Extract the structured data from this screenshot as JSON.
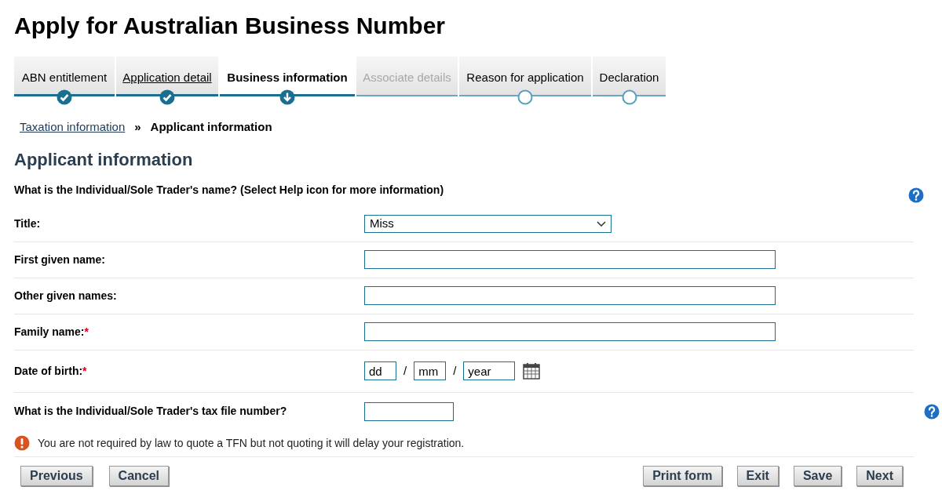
{
  "page_title": "Apply for Australian Business Number",
  "steps": [
    {
      "label": "ABN entitlement",
      "completed": true,
      "disabled": false,
      "link": false,
      "selected": false
    },
    {
      "label": "Application detail",
      "completed": true,
      "disabled": false,
      "link": true,
      "selected": false
    },
    {
      "label": "Business information",
      "completed": false,
      "disabled": false,
      "link": false,
      "selected": true
    },
    {
      "label": "Associate details",
      "completed": false,
      "disabled": true,
      "link": false,
      "selected": false
    },
    {
      "label": "Reason for application",
      "completed": false,
      "disabled": false,
      "link": false,
      "selected": false
    },
    {
      "label": "Declaration",
      "completed": false,
      "disabled": false,
      "link": false,
      "selected": false
    }
  ],
  "breadcrumb": {
    "items": [
      {
        "label": "Taxation information",
        "link": true
      },
      {
        "label": "Applicant information",
        "link": false
      }
    ],
    "separator": "»"
  },
  "section_heading": "Applicant information",
  "question": {
    "text": "What is the Individual/Sole Trader's name? (Select Help icon for more information)",
    "help": true
  },
  "rows": [
    {
      "kind": "select",
      "label": "Title:",
      "required": false,
      "value": "Miss",
      "help": false
    },
    {
      "kind": "text",
      "label": "First given name:",
      "required": false,
      "value": "",
      "help": false
    },
    {
      "kind": "text",
      "label": "Other given names:",
      "required": false,
      "value": "",
      "help": false
    },
    {
      "kind": "text",
      "label": "Family name:",
      "required": true,
      "value": "",
      "help": false
    },
    {
      "kind": "date",
      "label": "Date of birth:",
      "required": true,
      "parts": [
        "dd",
        "mm",
        "year"
      ],
      "separator": "/",
      "help": false
    },
    {
      "kind": "short",
      "label": "What is the Individual/Sole Trader's tax file number?",
      "required": false,
      "value": "",
      "help": true
    }
  ],
  "required_mark": "*",
  "notice": "You are not required by law to quote a TFN but not quoting it will delay your registration.",
  "buttons_left": [
    "Previous",
    "Cancel"
  ],
  "buttons_right": [
    "Print form",
    "Exit",
    "Save",
    "Next"
  ]
}
